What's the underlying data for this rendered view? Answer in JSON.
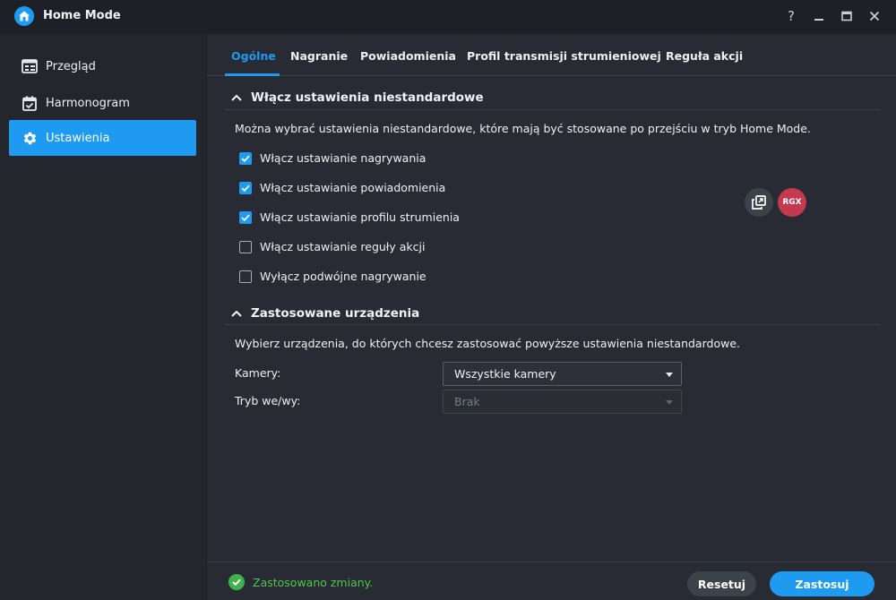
{
  "window": {
    "title": "Home Mode",
    "controls": [
      "help-icon",
      "minimize-icon",
      "maximize-icon",
      "close-icon"
    ]
  },
  "sidebar": {
    "items": [
      {
        "label": "Przegląd",
        "icon": "overview-icon"
      },
      {
        "label": "Harmonogram",
        "icon": "calendar-icon"
      },
      {
        "label": "Ustawienia",
        "icon": "gear-icon",
        "active": true
      }
    ]
  },
  "tabs": [
    {
      "label": "Ogólne",
      "active": true
    },
    {
      "label": "Nagranie"
    },
    {
      "label": "Powiadomienia"
    },
    {
      "label": "Profil transmisji strumieniowej"
    },
    {
      "label": "Reguła akcji"
    }
  ],
  "custom_settings": {
    "title": "Włącz ustawienia niestandardowe",
    "description": "Można wybrać ustawienia niestandardowe, które mają być stosowane po przejściu w tryb Home Mode.",
    "options": [
      {
        "label": "Włącz ustawianie nagrywania",
        "checked": true
      },
      {
        "label": "Włącz ustawianie powiadomienia",
        "checked": true
      },
      {
        "label": "Włącz ustawianie profilu strumienia",
        "checked": true
      },
      {
        "label": "Włącz ustawianie reguły akcji",
        "checked": false
      },
      {
        "label": "Wyłącz podwójne nagrywanie",
        "checked": false
      }
    ]
  },
  "floating": {
    "copy_icon": "copy-icon",
    "rgx_label": "RGX"
  },
  "devices": {
    "title": "Zastosowane urządzenia",
    "description": "Wybierz urządzenia, do których chcesz zastosować powyższe ustawienia niestandardowe.",
    "cameras_label": "Kamery:",
    "cameras_value": "Wszystkie kamery",
    "io_label": "Tryb we/wy:",
    "io_value": "Brak"
  },
  "footer": {
    "status": "Zastosowano zmiany.",
    "reset_label": "Resetuj",
    "apply_label": "Zastosuj"
  },
  "colors": {
    "accent": "#1e9bf0",
    "background": "#282b33",
    "success": "#53c64d",
    "rgx": "#c4394f"
  }
}
